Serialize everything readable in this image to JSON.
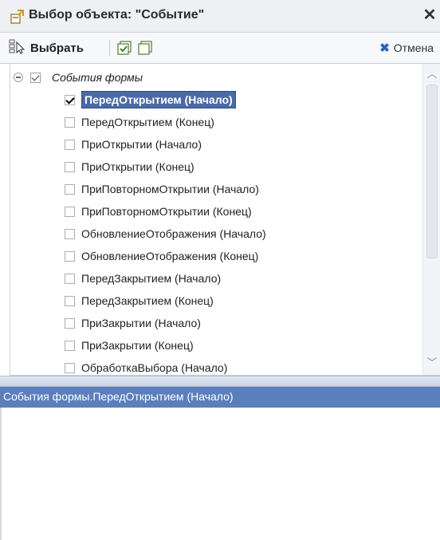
{
  "window": {
    "title": "Выбор объекта: \"Событие\"",
    "close_glyph": "✕"
  },
  "toolbar": {
    "select_label": "Выбрать",
    "cancel_label": "Отмена",
    "cancel_glyph": "✖",
    "accent_cancel": "#2c62c6"
  },
  "tree": {
    "root_label": "События формы",
    "root_checked": true,
    "items": [
      {
        "label": "ПередОткрытием (Начало)",
        "checked": true,
        "selected": true
      },
      {
        "label": "ПередОткрытием (Конец)",
        "checked": false
      },
      {
        "label": "ПриОткрытии (Начало)",
        "checked": false
      },
      {
        "label": "ПриОткрытии (Конец)",
        "checked": false
      },
      {
        "label": "ПриПовторномОткрытии (Начало)",
        "checked": false
      },
      {
        "label": "ПриПовторномОткрытии (Конец)",
        "checked": false
      },
      {
        "label": "ОбновлениеОтображения (Начало)",
        "checked": false
      },
      {
        "label": "ОбновлениеОтображения (Конец)",
        "checked": false
      },
      {
        "label": "ПередЗакрытием (Начало)",
        "checked": false
      },
      {
        "label": "ПередЗакрытием (Конец)",
        "checked": false
      },
      {
        "label": "ПриЗакрытии (Начало)",
        "checked": false
      },
      {
        "label": "ПриЗакрытии (Конец)",
        "checked": false
      },
      {
        "label": "ОбработкаВыбора (Начало)",
        "checked": false
      }
    ]
  },
  "scrollbar": {
    "up_glyph": "︿",
    "down_glyph": "﹀"
  },
  "path": {
    "text": "События формы.ПередОткрытием (Начало)"
  },
  "colors": {
    "selection": "#4a6aa5",
    "pathbar": "#5b7fbc"
  }
}
